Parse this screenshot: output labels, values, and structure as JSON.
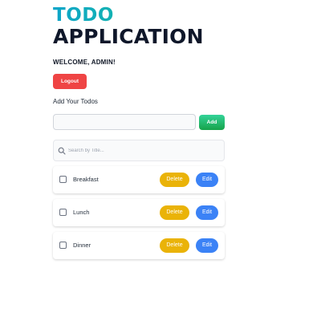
{
  "header": {
    "title_line1": "TODO",
    "title_line2": "APPLICATION",
    "welcome": "WELCOME, ADMIN!",
    "logout_label": "Logout"
  },
  "add_section": {
    "heading": "Add Your Todos",
    "input_value": "",
    "input_placeholder": "",
    "add_label": "Add"
  },
  "search": {
    "placeholder": "Search by Title...",
    "icon": "search-icon"
  },
  "todos": [
    {
      "title": "Breakfast",
      "checked": false,
      "delete_label": "Delete",
      "edit_label": "Edit"
    },
    {
      "title": "Lunch",
      "checked": false,
      "delete_label": "Delete",
      "edit_label": "Edit"
    },
    {
      "title": "Dinner",
      "checked": false,
      "delete_label": "Delete",
      "edit_label": "Edit"
    }
  ],
  "colors": {
    "logout": "#ef4444",
    "add": "#22c55e",
    "delete": "#eab308",
    "edit": "#3b82f6",
    "title_gradient_start": "#0ea5c9",
    "title_gradient_end": "#16a34a"
  }
}
